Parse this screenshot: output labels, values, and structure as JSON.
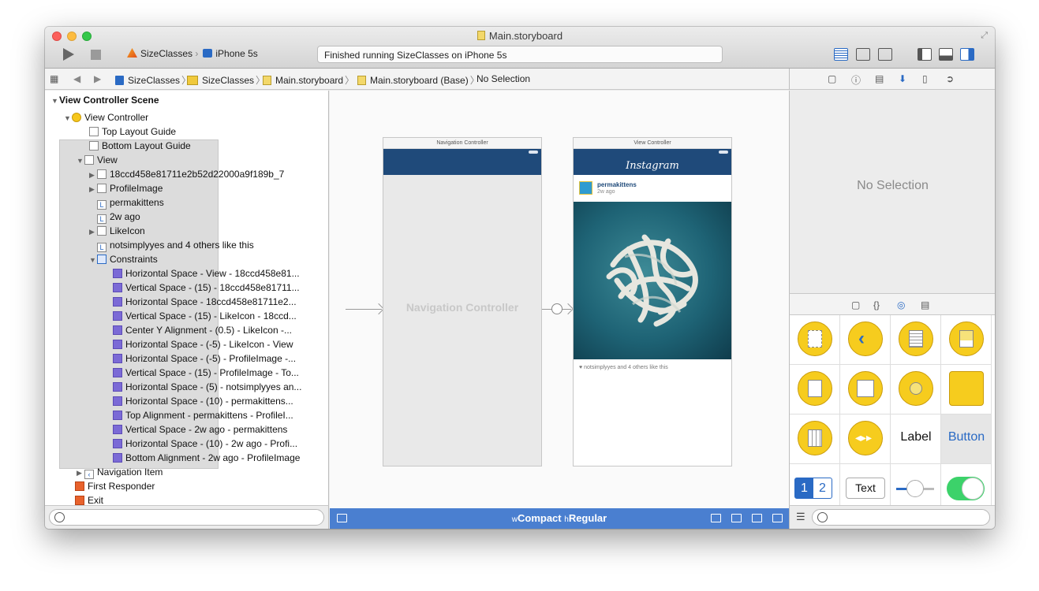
{
  "window": {
    "title": "Main.storyboard"
  },
  "toolbar": {
    "scheme": "SizeClasses",
    "device": "iPhone 5s",
    "status": "Finished running SizeClasses on iPhone 5s"
  },
  "jumpbar": [
    "SizeClasses",
    "SizeClasses",
    "Main.storyboard",
    "Main.storyboard (Base)",
    "No Selection"
  ],
  "outline": {
    "scene": "View Controller Scene",
    "vc": "View Controller",
    "top_guide": "Top Layout Guide",
    "bottom_guide": "Bottom Layout Guide",
    "view": "View",
    "children": [
      "18ccd458e81711e2b52d22000a9f189b_7",
      "ProfileImage",
      "permakittens",
      "2w ago",
      "LikeIcon",
      "notsimplyyes and 4 others like this"
    ],
    "constraints_label": "Constraints",
    "constraints": [
      "Horizontal Space - View - 18ccd458e81...",
      "Vertical Space - (15) - 18ccd458e81711...",
      "Horizontal Space - 18ccd458e81711e2...",
      "Vertical Space - (15) - LikeIcon - 18ccd...",
      "Center Y Alignment - (0.5) - LikeIcon -...",
      "Horizontal Space - (-5) - LikeIcon - View",
      "Horizontal Space - (-5) - ProfileImage -...",
      "Vertical Space - (15) - ProfileImage - To...",
      "Horizontal Space - (5) - notsimplyyes an...",
      "Horizontal Space - (10) - permakittens...",
      "Top Alignment - permakittens - ProfileI...",
      "Vertical Space - 2w ago - permakittens",
      "Horizontal Space - (10) - 2w ago - Profi...",
      "Bottom Alignment - 2w ago - ProfileImage"
    ],
    "nav_item": "Navigation Item",
    "first_responder": "First Responder",
    "exit": "Exit"
  },
  "canvas": {
    "nav_scene_title": "Navigation Controller",
    "nav_placeholder": "Navigation Controller",
    "vc_scene_title": "View Controller",
    "app_title": "Instagram",
    "username": "permakittens",
    "time": "2w ago",
    "likes": "notsimplyyes and 4 others like this"
  },
  "sizebar": {
    "w_prefix": "w",
    "w_value": "Compact",
    "h_prefix": "h",
    "h_value": "Regular"
  },
  "inspector": {
    "no_selection": "No Selection"
  },
  "library": {
    "label_item": "Label",
    "button_item": "Button",
    "text_item": "Text",
    "seg_1": "1",
    "seg_2": "2"
  }
}
